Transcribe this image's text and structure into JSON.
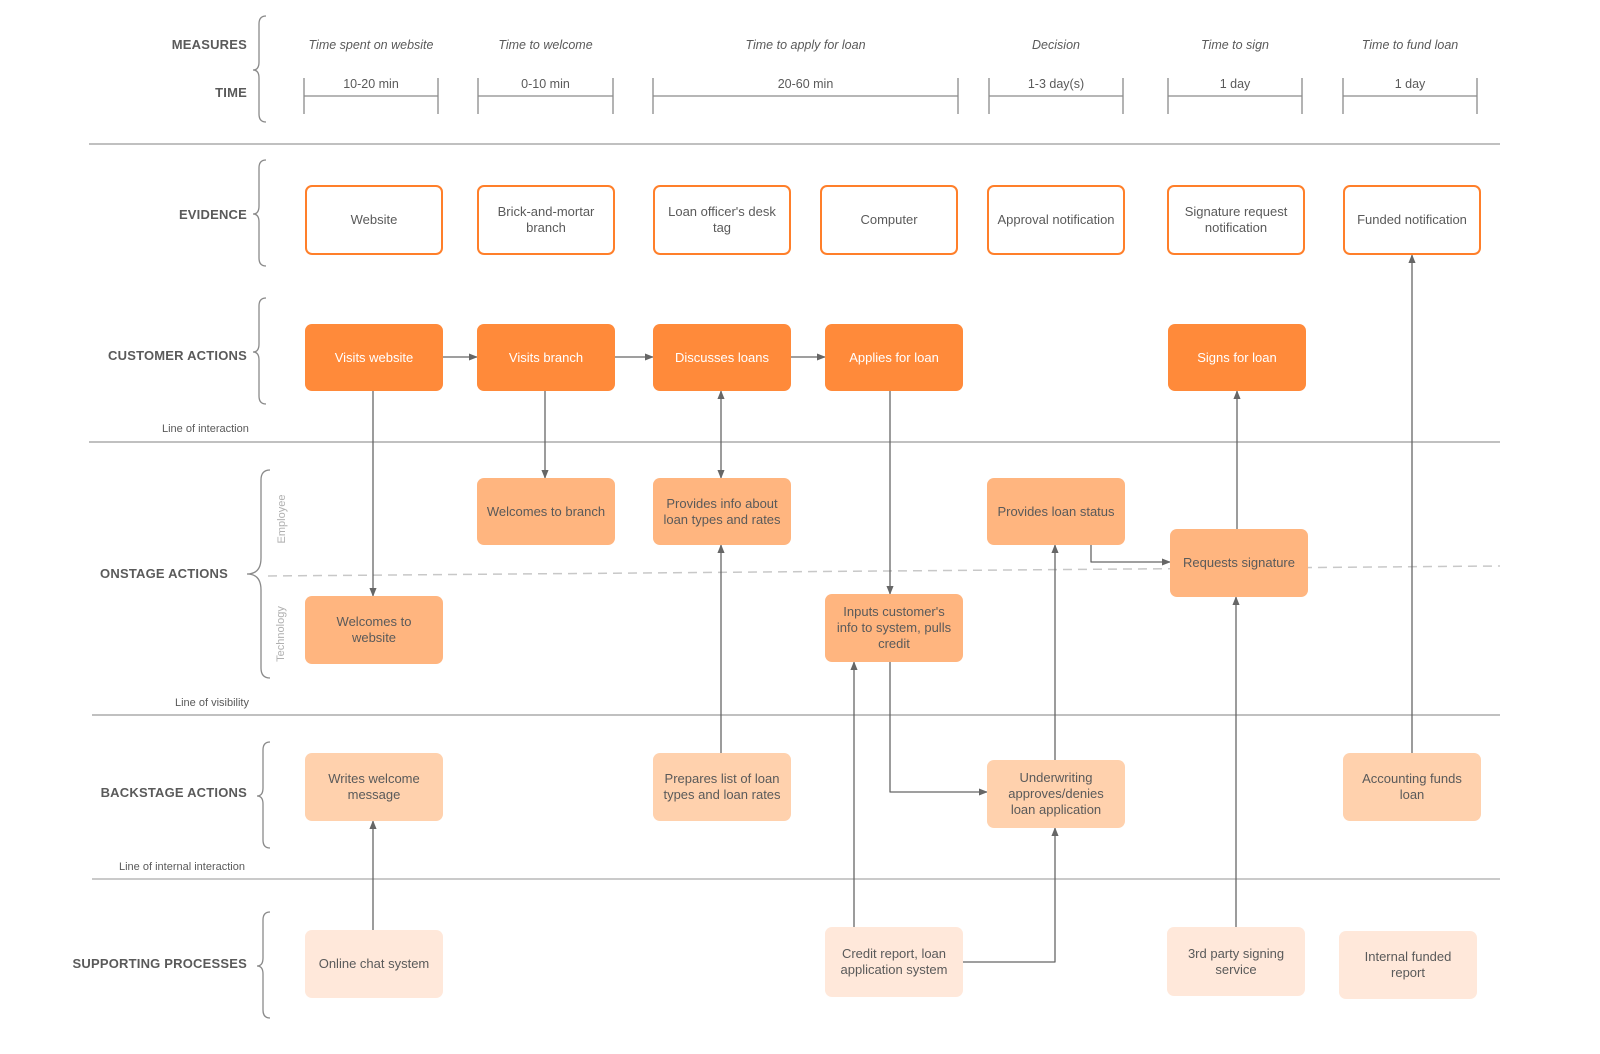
{
  "diagram": {
    "type": "service-blueprint",
    "colors": {
      "evidence_border": "#ff7f2a",
      "customer_fill": "#ff8a3a",
      "onstage_fill": "#ffb57f",
      "backstage_fill": "#ffd1ad",
      "support_fill": "#ffe8da",
      "connector": "#666666",
      "divider": "#9a9a9a",
      "dashed_divider": "#c8c8c8"
    },
    "lanes": {
      "measures": "MEASURES",
      "time": "TIME",
      "evidence": "EVIDENCE",
      "customer_actions": "CUSTOMER ACTIONS",
      "onstage_actions": "ONSTAGE ACTIONS",
      "backstage_actions": "BACKSTAGE ACTIONS",
      "supporting_processes": "SUPPORTING PROCESSES"
    },
    "onstage_sublanes": {
      "employee": "Employee",
      "technology": "Technology"
    },
    "lines": {
      "interaction": "Line of interaction",
      "visibility": "Line of visibility",
      "internal_interaction": "Line of internal interaction"
    },
    "measures": [
      {
        "label": "Time spent on website",
        "time": "10-20 min"
      },
      {
        "label": "Time to welcome",
        "time": "0-10 min"
      },
      {
        "label": "Time to apply for loan",
        "time": "20-60 min"
      },
      {
        "label": "Decision",
        "time": "1-3 day(s)"
      },
      {
        "label": "Time to sign",
        "time": "1 day"
      },
      {
        "label": "Time to fund loan",
        "time": "1 day"
      }
    ],
    "evidence": [
      {
        "id": "ev-website",
        "text": "Website"
      },
      {
        "id": "ev-branch",
        "text": "Brick-and-mortar branch"
      },
      {
        "id": "ev-desk-tag",
        "text": "Loan officer's desk tag"
      },
      {
        "id": "ev-computer",
        "text": "Computer"
      },
      {
        "id": "ev-approval",
        "text": "Approval notification"
      },
      {
        "id": "ev-signature",
        "text": "Signature request notification"
      },
      {
        "id": "ev-funded",
        "text": "Funded notification"
      }
    ],
    "customer_actions": [
      {
        "id": "ca-visits-website",
        "text": "Visits website"
      },
      {
        "id": "ca-visits-branch",
        "text": "Visits branch"
      },
      {
        "id": "ca-discusses-loans",
        "text": "Discusses loans"
      },
      {
        "id": "ca-applies",
        "text": "Applies for loan"
      },
      {
        "id": "ca-signs",
        "text": "Signs for loan"
      }
    ],
    "onstage_actions": [
      {
        "id": "on-welcomes-branch",
        "text": "Welcomes to branch"
      },
      {
        "id": "on-provides-info",
        "text": "Provides info about loan types and rates"
      },
      {
        "id": "on-provides-status",
        "text": "Provides loan status"
      },
      {
        "id": "on-requests-signature",
        "text": "Requests signature"
      },
      {
        "id": "on-welcomes-website",
        "text": "Welcomes to website"
      },
      {
        "id": "on-inputs-info",
        "text": "Inputs customer's info to system, pulls credit"
      }
    ],
    "backstage_actions": [
      {
        "id": "bs-writes-welcome",
        "text": "Writes welcome message"
      },
      {
        "id": "bs-prepares-list",
        "text": "Prepares list of loan types and loan rates"
      },
      {
        "id": "bs-underwriting",
        "text": "Underwriting approves/denies loan application"
      },
      {
        "id": "bs-accounting",
        "text": "Accounting funds loan"
      }
    ],
    "supporting_processes": [
      {
        "id": "sp-chat",
        "text": "Online chat system"
      },
      {
        "id": "sp-credit",
        "text": "Credit report, loan application system"
      },
      {
        "id": "sp-signing",
        "text": "3rd party signing service"
      },
      {
        "id": "sp-funded-report",
        "text": "Internal funded report"
      }
    ],
    "connectors": [
      {
        "from": "ca-visits-website",
        "to": "ca-visits-branch"
      },
      {
        "from": "ca-visits-branch",
        "to": "ca-discusses-loans"
      },
      {
        "from": "ca-discusses-loans",
        "to": "ca-applies"
      },
      {
        "from": "ca-visits-website",
        "to": "on-welcomes-website"
      },
      {
        "from": "ca-visits-branch",
        "to": "on-welcomes-branch"
      },
      {
        "from": "on-provides-info",
        "to": "ca-discusses-loans",
        "bidirectional": true
      },
      {
        "from": "ca-applies",
        "to": "on-inputs-info"
      },
      {
        "from": "on-requests-signature",
        "to": "ca-signs"
      },
      {
        "from": "bs-accounting",
        "to": "ev-funded"
      },
      {
        "from": "on-provides-status",
        "to": "on-requests-signature"
      },
      {
        "from": "bs-prepares-list",
        "to": "on-provides-info"
      },
      {
        "from": "sp-credit",
        "to": "on-inputs-info"
      },
      {
        "from": "on-inputs-info",
        "to": "bs-underwriting"
      },
      {
        "from": "bs-underwriting",
        "to": "on-provides-status"
      },
      {
        "from": "sp-credit",
        "to": "bs-underwriting"
      },
      {
        "from": "sp-signing",
        "to": "on-requests-signature"
      },
      {
        "from": "sp-chat",
        "to": "bs-writes-welcome"
      }
    ]
  }
}
